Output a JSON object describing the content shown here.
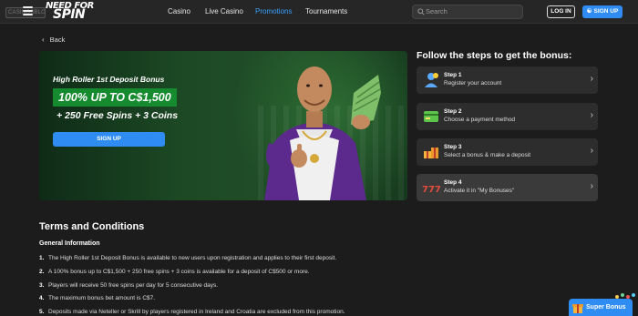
{
  "header": {
    "casino_tag": "CASINOSBLOG",
    "logo": {
      "line1": "NEED FOR",
      "line2": "SPIN"
    },
    "nav": [
      {
        "label": "Casino"
      },
      {
        "label": "Live Casino"
      },
      {
        "label": "Promotions",
        "active": true
      },
      {
        "label": "Tournaments"
      }
    ],
    "search_placeholder": "Search",
    "login_label": "LOG IN",
    "signup_label": "SIGN UP"
  },
  "back_label": "Back",
  "hero": {
    "subtitle": "High Roller 1st Deposit Bonus",
    "offer": "100% UP TO C$1,500",
    "extra": "+ 250 Free Spins + 3 Coins",
    "cta": "SIGN UP"
  },
  "steps": {
    "title": "Follow the steps to get the bonus:",
    "items": [
      {
        "title": "Step 1",
        "desc": "Register your account",
        "icon": "user-plus-icon"
      },
      {
        "title": "Step 2",
        "desc": "Choose a payment method",
        "icon": "credit-card-icon"
      },
      {
        "title": "Step 3",
        "desc": "Select a bonus & make a deposit",
        "icon": "gift-boxes-icon"
      },
      {
        "title": "Step 4",
        "desc": "Activate it in \"My Bonuses\"",
        "icon": "slot-777-icon"
      }
    ]
  },
  "terms": {
    "title": "Terms and Conditions",
    "section": "General Information",
    "items": [
      {
        "n": "1.",
        "text": "The High Roller 1st Deposit Bonus is available to new users upon registration and applies to their first deposit."
      },
      {
        "n": "2.",
        "text": "A 100% bonus up to C$1,500 + 250 free spins + 3 coins is available for a deposit of C$500 or more."
      },
      {
        "n": "3.",
        "text": "Players will receive 50 free spins per day for 5 consecutive days."
      },
      {
        "n": "4.",
        "text": "The maximum bonus bet amount is C$7."
      },
      {
        "n": "5.",
        "text": "Deposits made via Neteller or Skrill by players registered in Ireland and Croatia are excluded from this promotion."
      }
    ]
  },
  "super_bonus_label": "Super Bonus",
  "colors": {
    "accent": "#2f8cf2",
    "offer_bg": "#158a2e",
    "bg": "#1c1c1c"
  }
}
